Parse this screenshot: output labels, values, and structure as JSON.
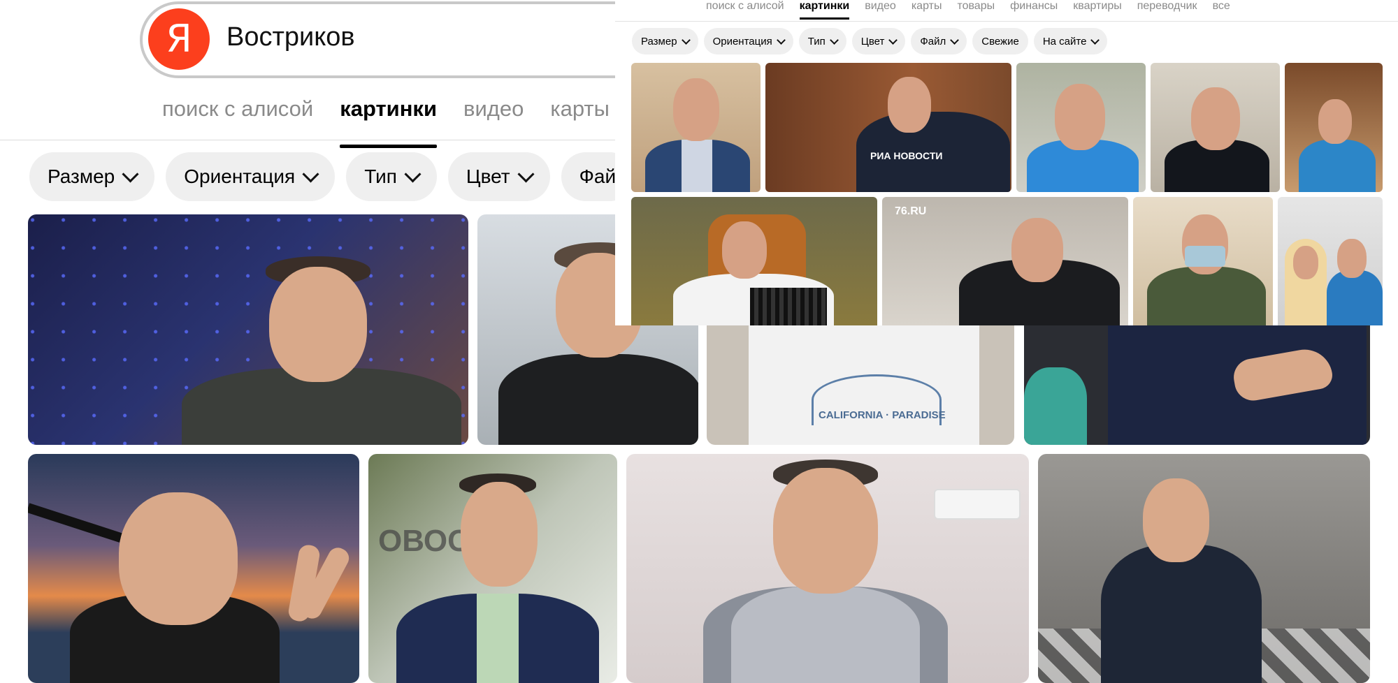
{
  "search": {
    "logo_letter": "Я",
    "query": "Востриков"
  },
  "big_tabs": [
    "поиск с алисой",
    "картинки",
    "видео",
    "карты"
  ],
  "big_filters": [
    "Размер",
    "Ориентация",
    "Тип",
    "Цвет",
    "Фай"
  ],
  "small_tabs": [
    "поиск с алисой",
    "картинки",
    "видео",
    "карты",
    "товары",
    "финансы",
    "квартиры",
    "переводчик",
    "все"
  ],
  "small_filters": [
    "Размер",
    "Ориентация",
    "Тип",
    "Цвет",
    "Файл",
    "Свежие",
    "На сайте"
  ],
  "watermarks": {
    "ria": "РИА НОВОСТИ",
    "site76": "76.RU"
  },
  "shirt_text": "CALIFORNIA · PARADISE"
}
